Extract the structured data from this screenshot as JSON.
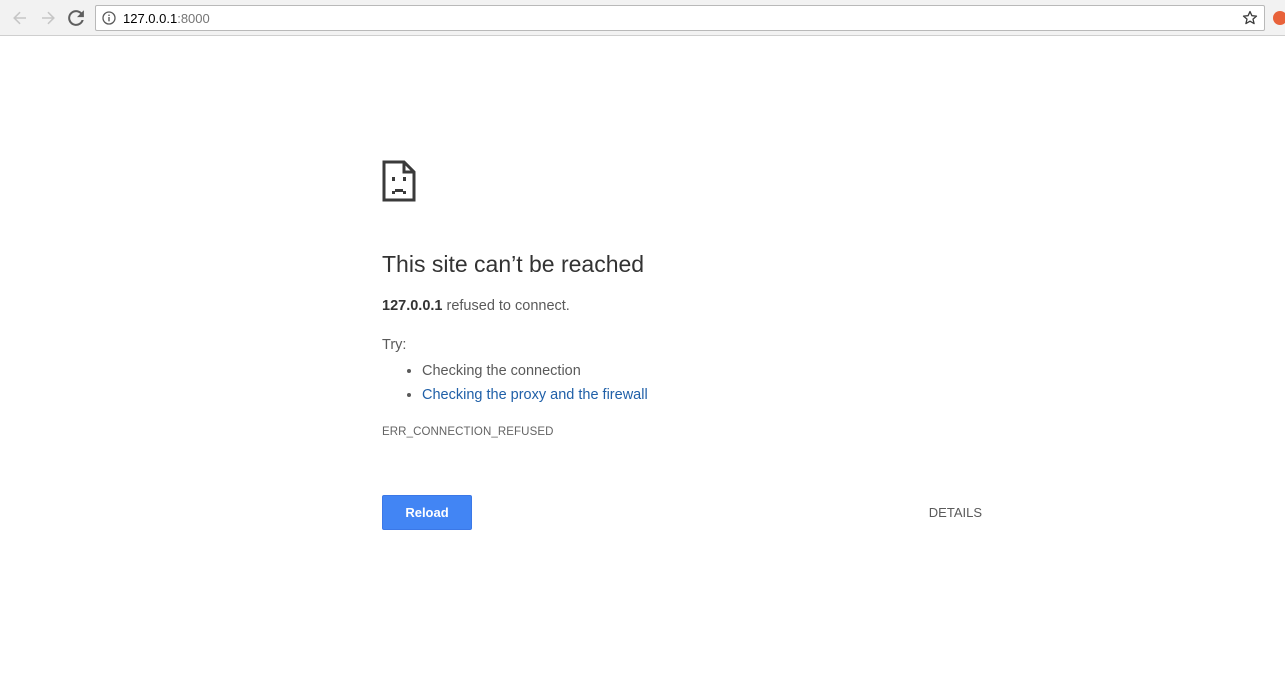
{
  "browser": {
    "url_host": "127.0.0.1",
    "url_port": ":8000",
    "icons": {
      "back": "arrow-left-icon",
      "forward": "arrow-right-icon",
      "reload": "reload-icon",
      "info": "info-icon",
      "bookmark": "star-icon",
      "extension": "extension-icon"
    },
    "colors": {
      "extension": "#e8623a"
    }
  },
  "error_page": {
    "icon": "sad-document-icon",
    "title": "This site can’t be reached",
    "host": "127.0.0.1",
    "summary_suffix": " refused to connect.",
    "try_label": "Try:",
    "suggestions": [
      "Checking the connection",
      "Checking the proxy and the firewall"
    ],
    "error_code": "ERR_CONNECTION_REFUSED",
    "reload_label": "Reload",
    "details_label": "DETAILS",
    "colors": {
      "reload_button": "#4285f4",
      "link": "#2060a8",
      "title": "#333333",
      "body_text": "#5a5a5a"
    }
  }
}
